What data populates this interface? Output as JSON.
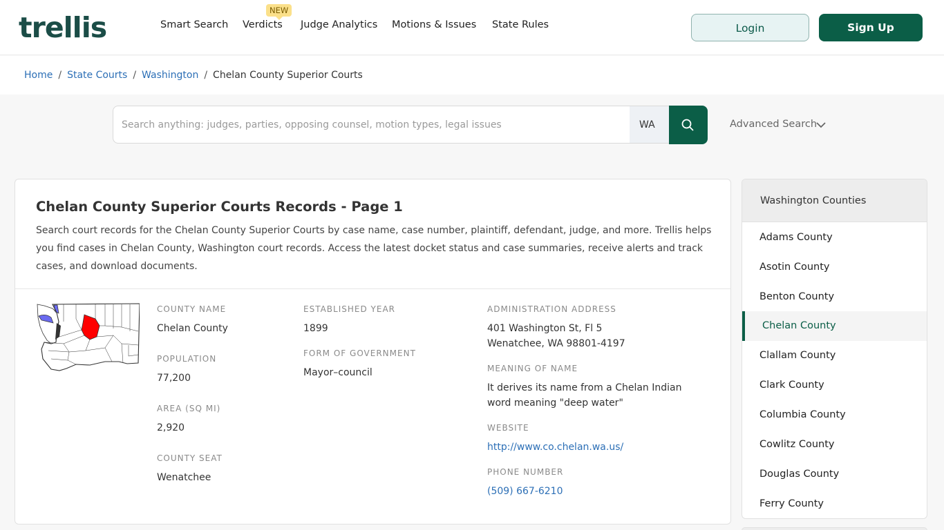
{
  "header": {
    "logo": "trellis",
    "nav": [
      {
        "label": "Smart Search"
      },
      {
        "label": "Verdicts"
      },
      {
        "label": "Judge Analytics"
      },
      {
        "label": "Motions & Issues"
      },
      {
        "label": "State Rules"
      }
    ],
    "new_badge": "NEW",
    "login_label": "Login",
    "signup_label": "Sign Up"
  },
  "breadcrumb": {
    "items": [
      "Home",
      "State Courts",
      "Washington"
    ],
    "current": "Chelan County Superior Courts",
    "separator": "/"
  },
  "search": {
    "placeholder": "Search anything: judges, parties, opposing counsel, motion types, legal issues",
    "value": "",
    "state": "WA",
    "advanced_label": "Advanced Search"
  },
  "main": {
    "title": "Chelan County Superior Courts Records - Page 1",
    "description": "Search court records for the Chelan County Superior Courts by case name, case number, plaintiff, defendant, judge, and more. Trellis helps you find cases in Chelan County, Washington court records. Access the latest docket status and case summaries, receive alerts and track cases, and download documents.",
    "fields": {
      "county_name": {
        "label": "COUNTY NAME",
        "value": "Chelan County"
      },
      "population": {
        "label": "POPULATION",
        "value": "77,200"
      },
      "area": {
        "label": "AREA (SQ MI)",
        "value": "2,920"
      },
      "county_seat": {
        "label": "COUNTY SEAT",
        "value": "Wenatchee"
      },
      "established": {
        "label": "ESTABLISHED YEAR",
        "value": "1899"
      },
      "government": {
        "label": "FORM OF GOVERNMENT",
        "value": "Mayor–council"
      },
      "address": {
        "label": "ADMINISTRATION ADDRESS",
        "line1": "401 Washington St, Fl 5",
        "line2": "Wenatchee, WA 98801-4197"
      },
      "meaning": {
        "label": "MEANING OF NAME",
        "line1": "It derives its name from a Chelan Indian",
        "line2": "word meaning \"deep water\""
      },
      "website": {
        "label": "WEBSITE",
        "value": "http://www.co.chelan.wa.us/"
      },
      "phone": {
        "label": "PHONE NUMBER",
        "value": "(509) 667-6210"
      }
    },
    "map_colors": {
      "highlight": "#ff0000",
      "water": "#6a6af0",
      "outline": "#333333"
    }
  },
  "sidebar": {
    "title": "Washington Counties",
    "items": [
      {
        "label": "Adams County"
      },
      {
        "label": "Asotin County"
      },
      {
        "label": "Benton County"
      },
      {
        "label": "Chelan County",
        "active": true
      },
      {
        "label": "Clallam County"
      },
      {
        "label": "Clark County"
      },
      {
        "label": "Columbia County"
      },
      {
        "label": "Cowlitz County"
      },
      {
        "label": "Douglas County"
      },
      {
        "label": "Ferry County"
      }
    ]
  },
  "colors": {
    "brand": "#0b5e47",
    "link": "#2c6fb6",
    "logo": "#1b4d47"
  }
}
